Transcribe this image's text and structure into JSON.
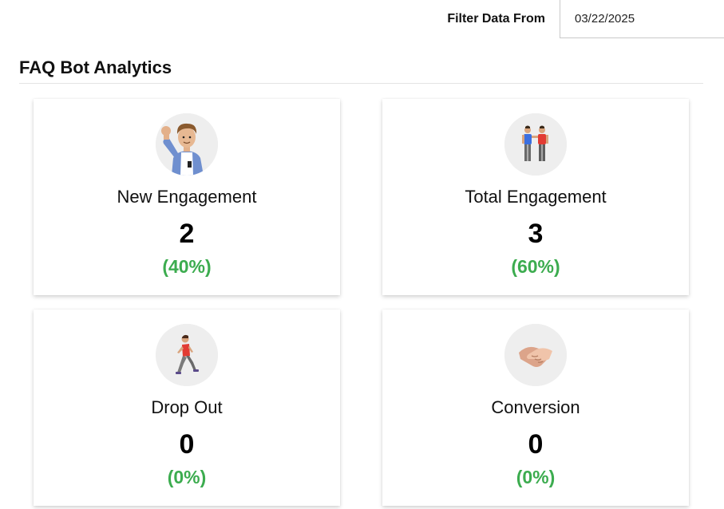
{
  "filter": {
    "label": "Filter Data From",
    "date_value": "03/22/2025"
  },
  "section": {
    "title": "FAQ Bot Analytics"
  },
  "colors": {
    "percent": "#3cac4f",
    "avatar_bg": "#eeeeee"
  },
  "cards": [
    {
      "label": "New Engagement",
      "value": "2",
      "percent": "(40%)",
      "icon": "waving-person-icon"
    },
    {
      "label": "Total Engagement",
      "value": "3",
      "percent": "(60%)",
      "icon": "two-people-icon"
    },
    {
      "label": "Drop Out",
      "value": "0",
      "percent": "(0%)",
      "icon": "walking-person-icon"
    },
    {
      "label": "Conversion",
      "value": "0",
      "percent": "(0%)",
      "icon": "handshake-icon"
    }
  ]
}
